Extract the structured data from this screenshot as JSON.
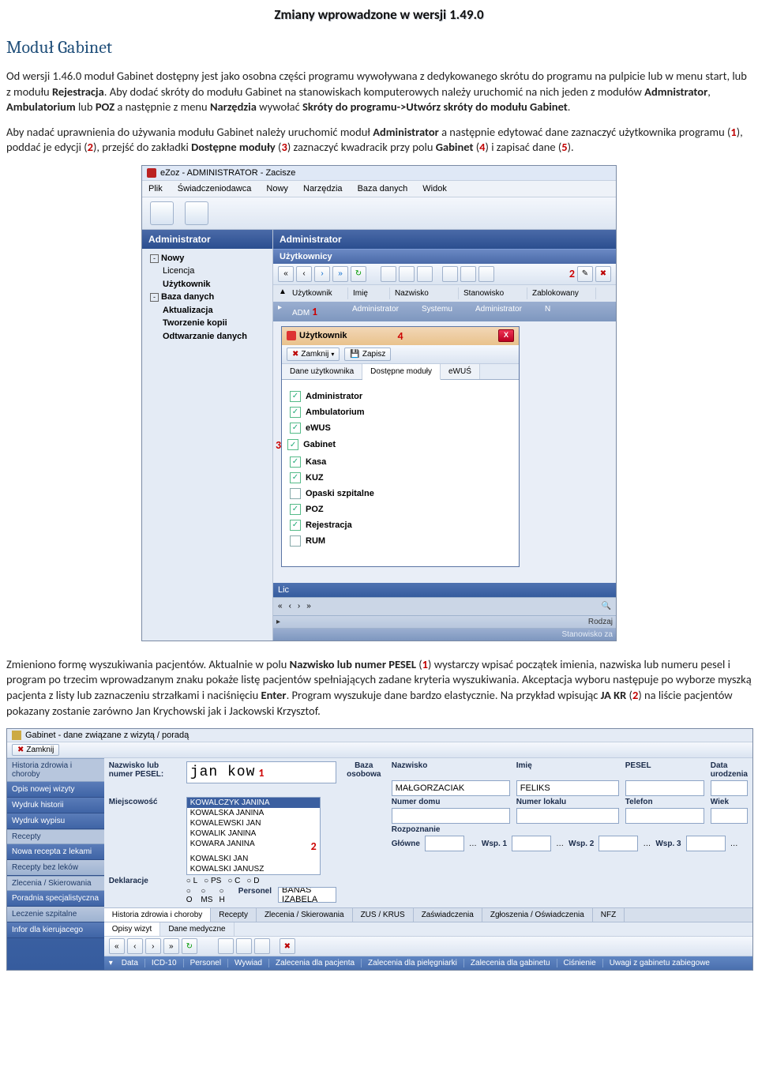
{
  "doc": {
    "title": "Zmiany wprowadzone w wersji 1.49.0",
    "section": "Moduł Gabinet",
    "p1a": "Od wersji 1.46.0 moduł Gabinet dostępny jest jako osobna części programu wywoływana z dedykowanego skrótu do programu na pulpicie lub w menu start, lub z modułu ",
    "p1b": "Rejestracja",
    "p1c": ". Aby dodać skróty do modułu Gabinet na stanowiskach komputerowych należy uruchomić na nich jeden z modułów ",
    "p1d": "Admnistrator",
    "p1e": ", ",
    "p1f": "Ambulatorium",
    "p1g": " lub ",
    "p1h": "POZ",
    "p1i": " a następnie z menu ",
    "p1j": "Narzędzia",
    "p1k": " wywołać ",
    "p1l": "Skróty do programu->Utwórz skróty do modułu Gabinet",
    "p1m": ".",
    "p2a": "Aby nadać uprawnienia do używania modułu Gabinet należy uruchomić moduł ",
    "p2b": "Administrator",
    "p2c": " a następnie edytować dane zaznaczyć użytkownika programu (",
    "p2d": "1",
    "p2e": "), poddać je edycji (",
    "p2f": "2",
    "p2g": "), przejść do zakładki ",
    "p2h": "Dostępne moduły",
    "p2i": " (",
    "p2j": "3",
    "p2k": ") zaznaczyć kwadracik przy polu ",
    "p2l": "Gabinet",
    "p2m": " (",
    "p2n": "4",
    "p2o": ") i zapisać dane (",
    "p2p": "5",
    "p2q": ").",
    "p3": "Zmieniono formę wyszukiwania pacjentów. Aktualnie w polu ",
    "p3b": "Nazwisko lub numer PESEL",
    "p3c": " (",
    "p3d": "1",
    "p3e": ") wystarczy wpisać początek imienia, nazwiska lub numeru pesel i program po trzecim wprowadzanym znaku pokaże listę pacjentów spełniających zadane kryteria wyszukiwania. Akceptacja wyboru następuje po wyborze myszką pacjenta z listy lub zaznaczeniu strzałkami i naciśnięciu ",
    "p3f": "Enter",
    "p3g": ". Program wyszukuje dane bardzo elastycznie. Na przykład wpisując ",
    "p3h": "JA KR",
    "p3i": " (",
    "p3j": "2",
    "p3k": ") na liście pacjentów pokazany zostanie zarówno Jan Krychowski jak i Jackowski Krzysztof."
  },
  "shot1": {
    "windowTitle": "eZoz - ADMINISTRATOR - Zacisze",
    "menus": [
      "Plik",
      "Świadczeniodawca",
      "Nowy",
      "Narzędzia",
      "Baza danych",
      "Widok"
    ],
    "nav_header": "Administrator",
    "tree": {
      "n1": "Nowy",
      "n1a": "Licencja",
      "n1b": "Użytkownik",
      "n2": "Baza danych",
      "n2a": "Aktualizacja",
      "n2b": "Tworzenie kopii",
      "n2c": "Odtwarzanie danych"
    },
    "main_header": "Administrator",
    "sub_header": "Użytkownicy",
    "grid_cols": [
      "Użytkownik",
      "Imię",
      "Nazwisko",
      "Stanowisko",
      "Zablokowany"
    ],
    "grid_row": [
      "ADM",
      "Administrator",
      "Systemu",
      "Administrator",
      "N"
    ],
    "marks": {
      "m1": "1",
      "m2": "2",
      "m3": "3",
      "m4": "4"
    },
    "dlg": {
      "title": "Użytkownik",
      "close_label": "Zamknij",
      "save_label": "Zapisz",
      "tabs": [
        "Dane użytkownika",
        "Dostępne moduły",
        "eWUŚ"
      ],
      "checks": [
        {
          "label": "Administrator",
          "checked": true
        },
        {
          "label": "Ambulatorium",
          "checked": true
        },
        {
          "label": "eWUS",
          "checked": true
        },
        {
          "label": "Gabinet",
          "checked": true
        },
        {
          "label": "Kasa",
          "checked": true
        },
        {
          "label": "KUZ",
          "checked": true
        },
        {
          "label": "Opaski szpitalne",
          "checked": false
        },
        {
          "label": "POZ",
          "checked": true
        },
        {
          "label": "Rejestracja",
          "checked": true
        },
        {
          "label": "RUM",
          "checked": false
        }
      ]
    },
    "lic_label": "Lic",
    "lic_right": "Rodzaj",
    "status": "Stanowisko za"
  },
  "shot2": {
    "windowTitle": "Gabinet - dane związane z wizytą / poradą",
    "close": "Zamknij",
    "side": {
      "g1": "Historia zdrowia i choroby",
      "b1": "Opis nowej wizyty",
      "b2": "Wydruk historii",
      "b3": "Wydruk wypisu",
      "g2": "Recepty",
      "b4": "Nowa recepta z lekami",
      "b5": "Recepty bez leków",
      "g3": "Zlecenia / Skierowania",
      "b6": "Poradnia specjalistyczna",
      "b7": "Leczenie szpitalne",
      "b8": "Infor dla kierujacego"
    },
    "labels": {
      "nazw": "Nazwisko lub numer PESEL:",
      "miej": "Miejscowość",
      "dekl": "Deklaracje",
      "pers": "Personel",
      "baza": "Baza osobowa",
      "nazw2": "Nazwisko",
      "imie": "Imię",
      "pesel": "PESEL",
      "data": "Data urodzenia",
      "numdom": "Numer domu",
      "numlok": "Numer lokalu",
      "tel": "Telefon",
      "wiek": "Wiek",
      "rozp": "Rozpoznanie",
      "glowne": "Główne",
      "wsp1": "Wsp. 1",
      "wsp2": "Wsp. 2",
      "wsp3": "Wsp. 3"
    },
    "search_value": "jan kow",
    "mark1": "1",
    "mark2": "2",
    "dropdown": [
      "KOWALCZYK JANINA",
      "KOWALSKA JANINA",
      "KOWALEWSKI JAN",
      "KOWALIK JANINA",
      "KOWARA JANINA",
      "KOWALSKI JAN",
      "KOWALSKI JANUSZ"
    ],
    "nazw_val": "MAŁGORZACIAK",
    "imie_val": "FELIKS",
    "dekl_opts": [
      "L",
      "PS",
      "C",
      "D"
    ],
    "dekl_opts2": [
      "O",
      "MS",
      "H"
    ],
    "personel_val": "BANAŚ IZABELA",
    "tabs": [
      "Historia zdrowia i choroby",
      "Recepty",
      "Zlecenia / Skierowania",
      "ZUS / KRUS",
      "Zaświadczenia",
      "Zgłoszenia / Oświadczenia",
      "NFZ"
    ],
    "subtabs": [
      "Opisy wizyt",
      "Dane medyczne"
    ],
    "bottom": [
      "Data",
      "ICD-10",
      "Personel",
      "Wywiad",
      "Zalecenia dla pacjenta",
      "Zalecenia dla pielęgniarki",
      "Zalecenia dla gabinetu",
      "Ciśnienie",
      "Uwagi z gabinetu zabiegowe"
    ]
  }
}
